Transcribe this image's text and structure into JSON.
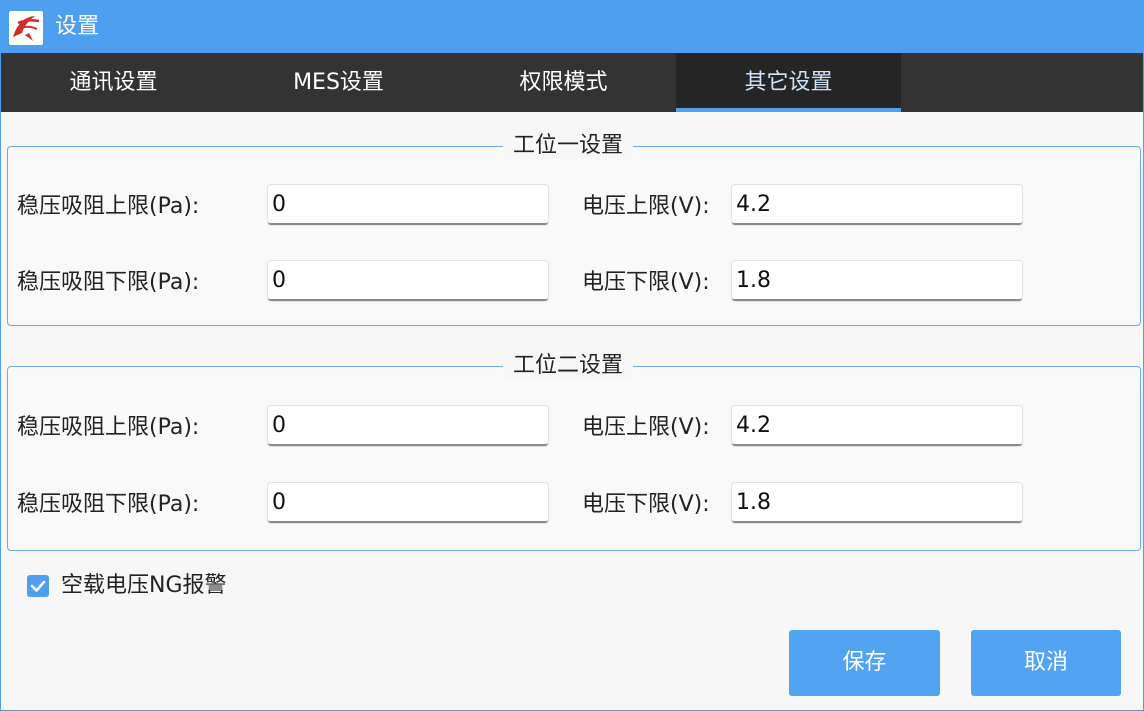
{
  "window": {
    "title": "设置",
    "icon": "app-logo-icon"
  },
  "tabs": [
    {
      "label": "通讯设置",
      "active": false
    },
    {
      "label": "MES设置",
      "active": false
    },
    {
      "label": "权限模式",
      "active": false
    },
    {
      "label": "其它设置",
      "active": true
    }
  ],
  "station1": {
    "title": "工位一设置",
    "pressure_upper_label": "稳压吸阻上限(Pa):",
    "pressure_upper_value": "0",
    "pressure_lower_label": "稳压吸阻下限(Pa):",
    "pressure_lower_value": "0",
    "voltage_upper_label": "电压上限(V):",
    "voltage_upper_value": "4.2",
    "voltage_lower_label": "电压下限(V):",
    "voltage_lower_value": "1.8"
  },
  "station2": {
    "title": "工位二设置",
    "pressure_upper_label": "稳压吸阻上限(Pa):",
    "pressure_upper_value": "0",
    "pressure_lower_label": "稳压吸阻下限(Pa):",
    "pressure_lower_value": "0",
    "voltage_upper_label": "电压上限(V):",
    "voltage_upper_value": "4.2",
    "voltage_lower_label": "电压下限(V):",
    "voltage_lower_value": "1.8"
  },
  "no_load_alarm": {
    "label": "空载电压NG报警",
    "checked": true,
    "icon": "checkmark-icon"
  },
  "buttons": {
    "save": "保存",
    "cancel": "取消"
  },
  "colors": {
    "accent": "#4f9ff0",
    "tabbar": "#333333",
    "button": "#52a3f2"
  }
}
